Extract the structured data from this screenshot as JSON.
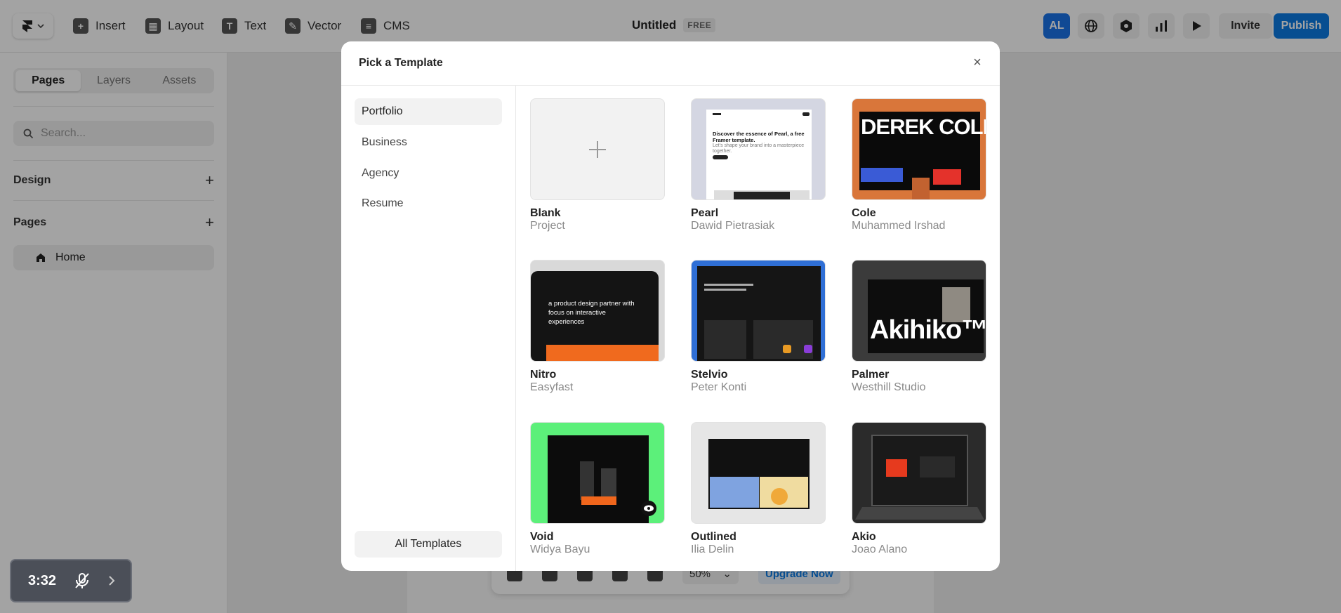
{
  "toolbar": {
    "insert": "Insert",
    "layout": "Layout",
    "text": "Text",
    "vector": "Vector",
    "cms": "CMS",
    "doc_title": "Untitled",
    "plan_badge": "FREE",
    "avatar_initials": "AL",
    "invite": "Invite",
    "publish": "Publish",
    "accent": "#0b7ae3"
  },
  "sidebar": {
    "tabs": [
      "Pages",
      "Layers",
      "Assets"
    ],
    "search_placeholder": "Search...",
    "design_label": "Design",
    "pages_label": "Pages",
    "home_page": "Home"
  },
  "canvas": {
    "zoom": "50%",
    "upgrade": "Upgrade Now"
  },
  "modal": {
    "title": "Pick a Template",
    "categories": [
      "Portfolio",
      "Business",
      "Agency",
      "Resume"
    ],
    "all_templates": "All Templates",
    "templates": [
      {
        "name": "Blank",
        "author": "Project"
      },
      {
        "name": "Pearl",
        "author": "Dawid Pietrasiak"
      },
      {
        "name": "Cole",
        "author": "Muhammed Irshad"
      },
      {
        "name": "Nitro",
        "author": "Easyfast"
      },
      {
        "name": "Stelvio",
        "author": "Peter Konti"
      },
      {
        "name": "Palmer",
        "author": "Westhill Studio"
      },
      {
        "name": "Void",
        "author": "Widya Bayu"
      },
      {
        "name": "Outlined",
        "author": "Ilia Delin"
      },
      {
        "name": "Akio",
        "author": "Joao Alano"
      }
    ],
    "thumb_text": {
      "pearl_heading": "Discover the essence of Pearl, a free Framer template.",
      "pearl_sub": "Let's shape your brand into a masterpiece together.",
      "cole_heading": "DEREK COLE",
      "nitro_heading": "a product design partner with focus on interactive experiences",
      "palmer_heading": "Akihiko™"
    }
  },
  "recording": {
    "time": "3:32"
  }
}
